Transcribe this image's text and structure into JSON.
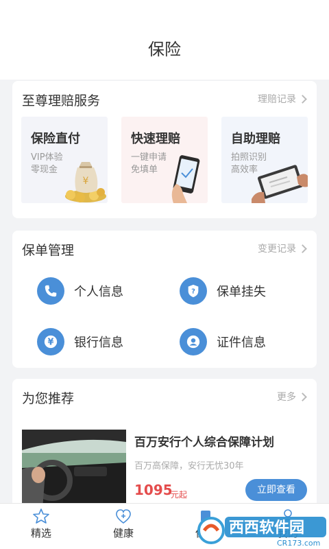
{
  "header": {
    "title": "保险"
  },
  "claims": {
    "title": "至尊理赔服务",
    "link": "理赔记录",
    "items": [
      {
        "title": "保险直付",
        "lines": [
          "VIP体验",
          "零现金"
        ],
        "bg": "#f3f4f9"
      },
      {
        "title": "快速理赔",
        "lines": [
          "一键申请",
          "免填单"
        ],
        "bg": "#fcf2f2"
      },
      {
        "title": "自助理赔",
        "lines": [
          "拍照识别",
          "高效率"
        ],
        "bg": "#f2f5fb"
      }
    ]
  },
  "policy": {
    "title": "保单管理",
    "link": "变更记录",
    "items": [
      {
        "label": "个人信息",
        "icon": "phone-icon"
      },
      {
        "label": "保单挂失",
        "icon": "shield-question-icon"
      },
      {
        "label": "银行信息",
        "icon": "yen-icon"
      },
      {
        "label": "证件信息",
        "icon": "id-person-icon"
      }
    ]
  },
  "recommend": {
    "title": "为您推荐",
    "link": "更多",
    "product": {
      "title": "百万安行个人综合保障计划",
      "desc": "百万高保障，安行无忧30年",
      "price": "1095",
      "price_unit": "元起",
      "button": "立即查看"
    }
  },
  "tabs": [
    {
      "label": "精选",
      "icon": "star-icon"
    },
    {
      "label": "健康",
      "icon": "heart-plus-icon"
    },
    {
      "label": "保险",
      "icon": "umbrella-icon"
    },
    {
      "label": "我的",
      "icon": "person-icon"
    }
  ],
  "watermark": {
    "text_cn": "西西软件园",
    "text_en": "CR173.com"
  },
  "colors": {
    "accent": "#4a8fd8",
    "price": "#e44c4c"
  }
}
